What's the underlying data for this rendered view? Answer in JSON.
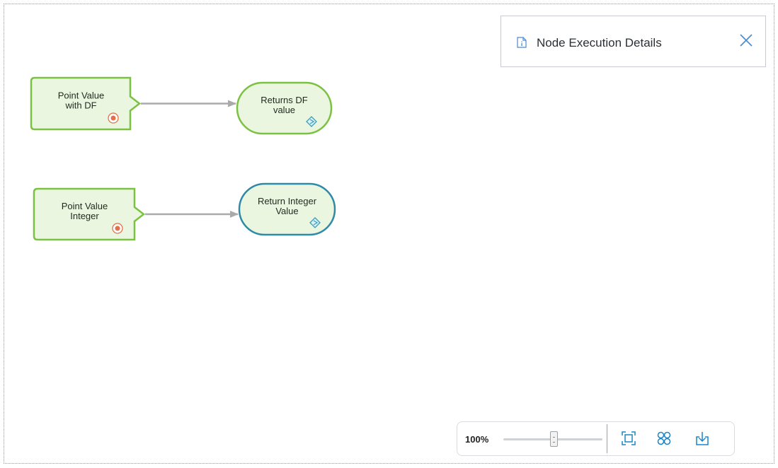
{
  "details_panel": {
    "title": "Node Execution Details",
    "icon": "info-document-icon",
    "close_icon": "close-icon"
  },
  "nodes": [
    {
      "id": "pv_df",
      "shape": "input-tag",
      "lines": [
        "Point Value",
        "with DF"
      ],
      "badge_icon": "target-icon",
      "border_color": "#7cc242"
    },
    {
      "id": "ret_df",
      "shape": "rounded",
      "lines": [
        "Returns DF",
        "value"
      ],
      "badge_icon": "diamond-icon",
      "border_color": "#7cc242"
    },
    {
      "id": "pv_int",
      "shape": "input-tag",
      "lines": [
        "Point Value",
        "Integer"
      ],
      "badge_icon": "target-icon",
      "border_color": "#7cc242"
    },
    {
      "id": "ret_int",
      "shape": "rounded",
      "lines": [
        "Return Integer",
        "Value"
      ],
      "badge_icon": "diamond-icon",
      "border_color": "#2e8aa8"
    }
  ],
  "edges": [
    {
      "from": "pv_df",
      "to": "ret_df"
    },
    {
      "from": "pv_int",
      "to": "ret_int"
    }
  ],
  "zoom_controls": {
    "zoom_label": "100%",
    "zoom_level": 1.0,
    "tools": [
      "fit-to-screen-icon",
      "layout-grid-icon",
      "download-icon"
    ]
  },
  "colors": {
    "node_fill": "#eaf6e0",
    "edge": "#aaaaaa",
    "target_badge": "#e4704a",
    "diamond_badge": "#3aa0b8",
    "tool_icon": "#1a85c8"
  }
}
